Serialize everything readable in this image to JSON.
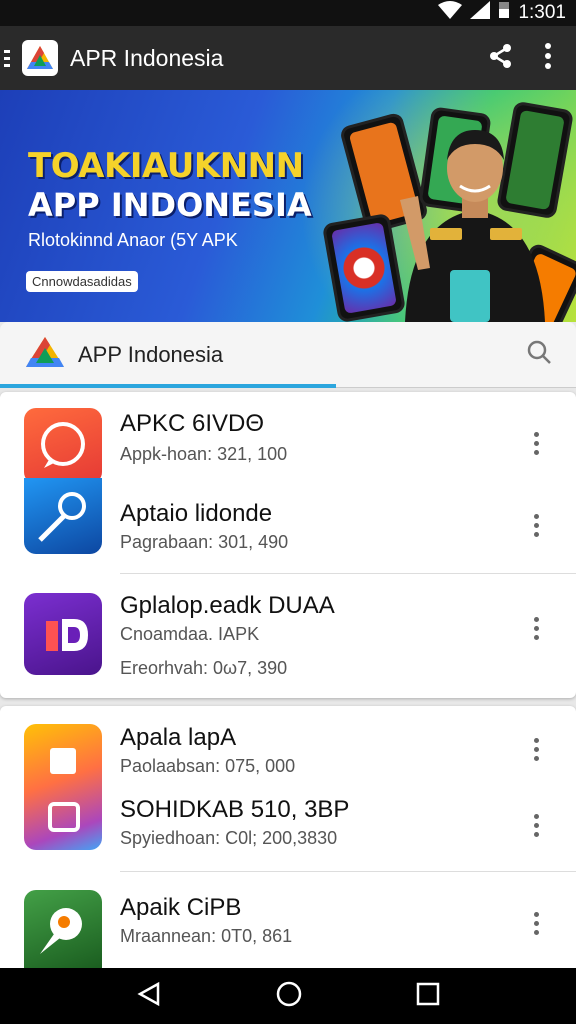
{
  "status": {
    "time": "1:301"
  },
  "appbar": {
    "title": "APR Indonesia"
  },
  "banner": {
    "headline": "TOAKIAUKNNN",
    "headline2": "APP INDONESIA",
    "subtitle": "Rlotokinnd Anaor (5Y APK",
    "cta": "Cnnowdasadidas"
  },
  "search": {
    "title": "APP Indonesia"
  },
  "list1": [
    {
      "title": "APKC 6IVDΘ",
      "sub": "Appk-hoan: 321, 100"
    },
    {
      "title": "Aptaio lidonde",
      "sub": "Pagrabaan: 301, 490"
    },
    {
      "title": "Gplalop.eadk DUAA",
      "sub": "Cnoamdaa. IAPK",
      "sub2": "Ereorhvah: 0ω7, 390"
    }
  ],
  "list2": [
    {
      "title": "Apala lapA",
      "sub": "Paolaabsan: 075, 000"
    },
    {
      "title": "SOHIDKAB 510, 3BP",
      "sub": "Spyiedhoan: C0l; 200,3830"
    },
    {
      "title": "Apaik CiPB",
      "sub": "Mraannean: 0T0, 861"
    }
  ],
  "colors": {
    "accent": "#2ca6de",
    "appbar": "#2a2a2a"
  }
}
